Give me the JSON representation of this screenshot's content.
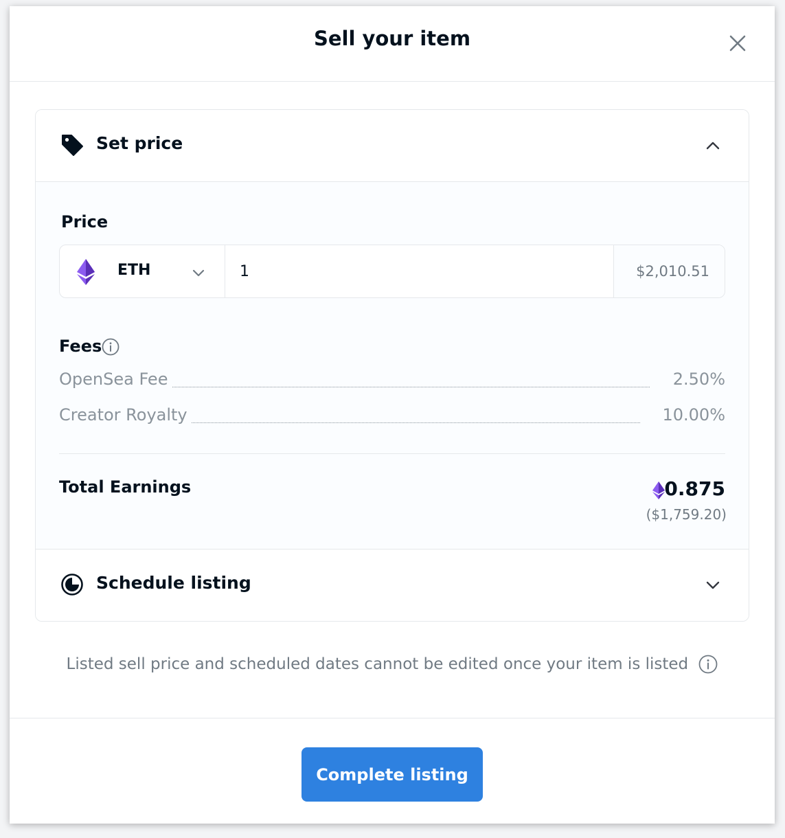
{
  "modal": {
    "title": "Sell your item"
  },
  "set_price": {
    "label": "Set price",
    "price_label": "Price",
    "currency": "ETH",
    "amount": "1",
    "usd_value": "$2,010.51"
  },
  "fees": {
    "title": "Fees",
    "items": [
      {
        "name": "OpenSea Fee",
        "value": "2.50%"
      },
      {
        "name": "Creator Royalty",
        "value": "10.00%"
      }
    ]
  },
  "total": {
    "label": "Total Earnings",
    "amount": "0.875",
    "usd": "($1,759.20)"
  },
  "schedule": {
    "label": "Schedule listing"
  },
  "notice": "Listed sell price and scheduled dates cannot be edited once your item is listed",
  "footer": {
    "button_label": "Complete listing"
  },
  "colors": {
    "accent": "#2081e2",
    "text": "#04111d",
    "muted": "#707a83",
    "eth": "#6f42c1"
  }
}
